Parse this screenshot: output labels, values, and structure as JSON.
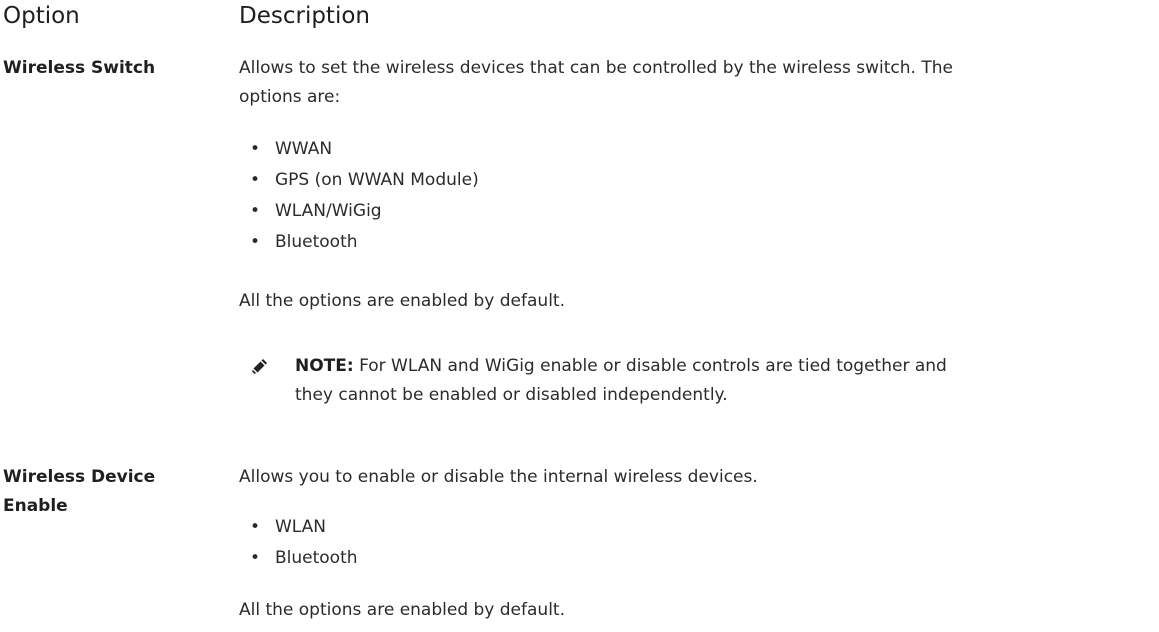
{
  "headers": {
    "option": "Option",
    "description": "Description"
  },
  "rows": [
    {
      "option": "Wireless Switch",
      "intro_line1": "Allows to set the wireless devices that can be controlled by the wireless switch. The",
      "intro_line2": "options are:",
      "bullets": [
        "WWAN",
        "GPS (on WWAN Module)",
        "WLAN/WiGig",
        "Bluetooth"
      ],
      "footer": "All the options are enabled by default.",
      "note": {
        "label": "NOTE:",
        "line1": " For WLAN and WiGig enable or disable controls are tied together and",
        "line2": "they cannot be enabled or disabled independently."
      }
    },
    {
      "option_line1": "Wireless Device",
      "option_line2": "Enable",
      "intro": "Allows you to enable or disable the internal wireless devices.",
      "bullets": [
        "WLAN",
        "Bluetooth"
      ],
      "footer": "All the options are enabled by default."
    }
  ],
  "bullet_char": "•",
  "icons": {
    "note": "pencil-icon"
  }
}
